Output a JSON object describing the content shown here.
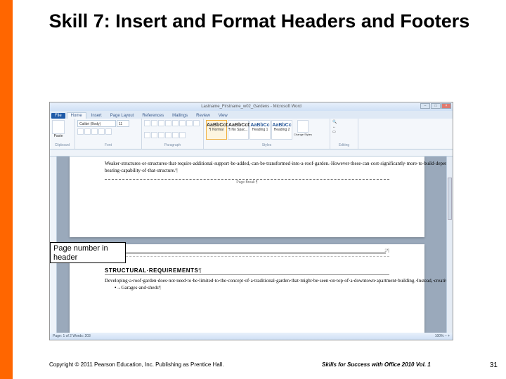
{
  "slide": {
    "title": "Skill 7: Insert and Format Headers and Footers",
    "callout": "Page number in header",
    "copyright": "Copyright © 2011 Pearson Education, Inc. Publishing as Prentice Hall.",
    "series": "Skills for Success with Office 2010 Vol. 1",
    "number": "31"
  },
  "word": {
    "titlebar": "Lastname_Firstname_w02_Gardens - Microsoft Word",
    "win_min": "–",
    "win_max": "□",
    "win_close": "×",
    "tabs": {
      "file": "File",
      "home": "Home",
      "insert": "Insert",
      "pagelayout": "Page Layout",
      "references": "References",
      "mailings": "Mailings",
      "review": "Review",
      "view": "View"
    },
    "ribbon": {
      "clipboard": "Clipboard",
      "paste": "Paste",
      "font_name": "Calibri (Body)",
      "font_size": "11",
      "font_label": "Font",
      "paragraph_label": "Paragraph",
      "styles_label": "Styles",
      "style1_sample": "AaBbCcDc",
      "style1_name": "¶ Normal",
      "style2_sample": "AaBbCcDc",
      "style2_name": "¶ No Spac...",
      "style3_sample": "AaBbCc",
      "style3_name": "Heading 1",
      "style4_sample": "AaBbCc",
      "style4_name": "Heading 2",
      "change_styles": "Change Styles",
      "editing": "Editing"
    },
    "doc": {
      "p1_line": "Weaker·structures·or·structures·that·require·additional·support·be·added,·can·be·transformed·into·a·roof·garden.·However·these·can·cost·significantly·more·to·build·depending·on·the·initial·weight-bearing·capability·of·that·structure.",
      "page_break": "Page Break",
      "header_mark": "¶",
      "header_page_num": "2",
      "heading": "STRUCTURAL·REQUIREMENTS",
      "p2_line": "Developing·a·roof·garden·does·not·need·to·be·limited·to·the·concept·of·a·traditional·garden·that·might·be·seen·on·top·of·a·downtown·apartment·building.·Instead,·creativity·is·imperative·as·other·structure·types·are·considered.·Some·of·these·alternatives·include:",
      "bullet1": "•→Garages·and·sheds"
    },
    "status_left": "Page: 1 of 2    Words: 203",
    "status_right": "100%  –  +"
  }
}
